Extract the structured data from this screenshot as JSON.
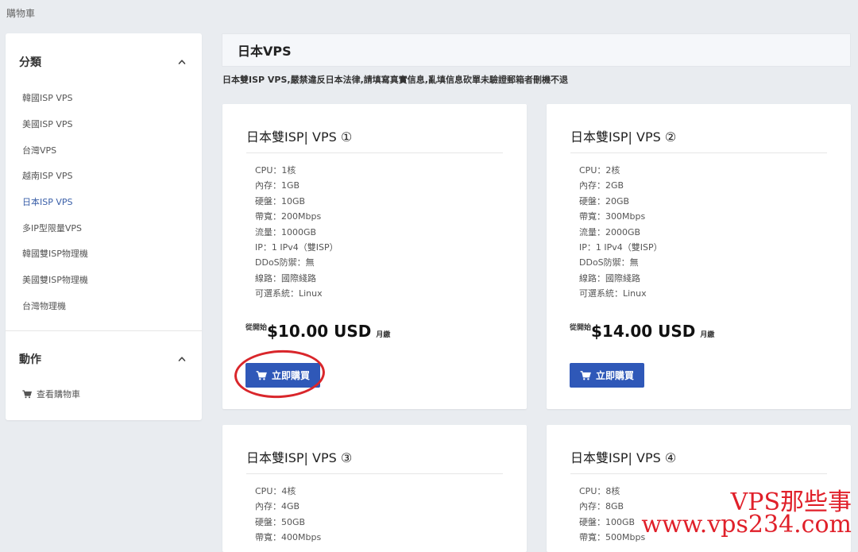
{
  "breadcrumb": "購物車",
  "sidebar": {
    "categories": {
      "title": "分類",
      "items": [
        {
          "label": "韓國ISP VPS",
          "active": false
        },
        {
          "label": "美國ISP VPS",
          "active": false
        },
        {
          "label": "台灣VPS",
          "active": false
        },
        {
          "label": "越南ISP VPS",
          "active": false
        },
        {
          "label": "日本ISP VPS",
          "active": true
        },
        {
          "label": "多IP型限量VPS",
          "active": false
        },
        {
          "label": "韓國雙ISP物理機",
          "active": false
        },
        {
          "label": "美國雙ISP物理機",
          "active": false
        },
        {
          "label": "台灣物理機",
          "active": false
        }
      ]
    },
    "actions": {
      "title": "動作",
      "view_cart": "查看購物車"
    }
  },
  "main": {
    "title": "日本VPS",
    "notice": "日本雙ISP VPS,嚴禁違反日本法律,請填寫真實信息,亂填信息砍單未驗證郵箱者刪機不退"
  },
  "products": [
    {
      "name": "日本雙ISP| VPS ①",
      "specs": [
        "CPU：1核",
        "內存：1GB",
        "硬盤：10GB",
        "帶寬：200Mbps",
        "流量：1000GB",
        "IP：1 IPv4（雙ISP）",
        "DDoS防禦：無",
        "線路：國際綫路",
        "可選系統：Linux"
      ],
      "price_prefix": "從開始",
      "price": "$10.00 USD",
      "cycle": "月繳",
      "buy_label": "立即購買"
    },
    {
      "name": "日本雙ISP| VPS ②",
      "specs": [
        "CPU：2核",
        "內存：2GB",
        "硬盤：20GB",
        "帶寬：300Mbps",
        "流量：2000GB",
        "IP：1 IPv4（雙ISP）",
        "DDoS防禦：無",
        "線路：國際綫路",
        "可選系統：Linux"
      ],
      "price_prefix": "從開始",
      "price": "$14.00 USD",
      "cycle": "月繳",
      "buy_label": "立即購買"
    },
    {
      "name": "日本雙ISP| VPS ③",
      "specs": [
        "CPU：4核",
        "內存：4GB",
        "硬盤：50GB",
        "帶寬：400Mbps"
      ]
    },
    {
      "name": "日本雙ISP| VPS ④",
      "specs": [
        "CPU：8核",
        "內存：8GB",
        "硬盤：100GB",
        "帶寬：500Mbps"
      ]
    }
  ],
  "watermark": {
    "line1": "VPS那些事",
    "line2": "www.vps234.com"
  },
  "colors": {
    "page_bg": "#e9ecf0",
    "button_blue": "#2f58b8",
    "active_link": "#3a5fa8",
    "annotation_red": "#d9262b"
  }
}
